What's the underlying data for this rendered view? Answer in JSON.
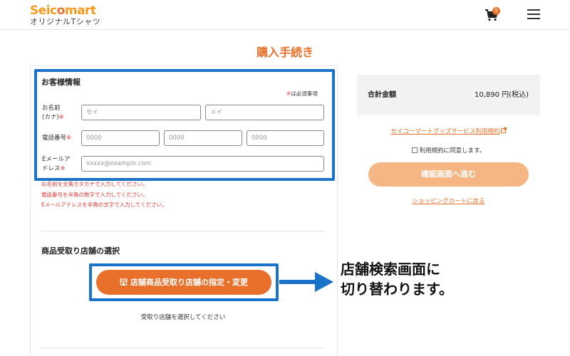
{
  "header": {
    "logo_main_prefix": "Seic",
    "logo_main_o": "o",
    "logo_main_suffix": "mart",
    "logo_sub": "オリジナルTシャツ",
    "cart_count": "5",
    "cart_icon": "cart-icon",
    "menu_icon": "hamburger-menu-icon"
  },
  "page_title": "購入手続き",
  "customer": {
    "title": "お客様情報",
    "required_note": "は必須事項",
    "required_mark": "※",
    "name_label_line1": "お名前",
    "name_label_line2": "(カナ)",
    "last_name_placeholder": "セイ",
    "first_name_placeholder": "メイ",
    "phone_label": "電話番号",
    "phone_placeholder_1": "0000",
    "phone_placeholder_2": "0000",
    "phone_placeholder_3": "0000",
    "email_label_line1": "Eメールア",
    "email_label_line2": "ドレス",
    "email_placeholder": "xxxxx@example.com",
    "errors": [
      "お名前を全角カタカナで入力してください。",
      "電話番号を半角の数字で入力してください。",
      "Eメールアドレスを半角の文字で入力してください。"
    ]
  },
  "store": {
    "title": "商品受取り店舗の選択",
    "button_label": "店舗商品受取り店舗の指定・変更",
    "button_icon": "store-icon",
    "note": "受取り店舗を選択してください"
  },
  "callout": {
    "line1": "店舗検索画面に",
    "line2": "切り替わります。"
  },
  "summary": {
    "total_label": "合計金額",
    "total_value": "10,890 円(税込)",
    "terms_link": "セイコーマートグッズサービス利用規約",
    "agree_label": "利用規約に同意します。",
    "confirm_button": "確認画面へ進む",
    "back_link": "ショッピングカートに戻る"
  },
  "colors": {
    "brand_orange": "#e8702a",
    "highlight_blue": "#1a73c9",
    "error_red": "#e53935"
  }
}
